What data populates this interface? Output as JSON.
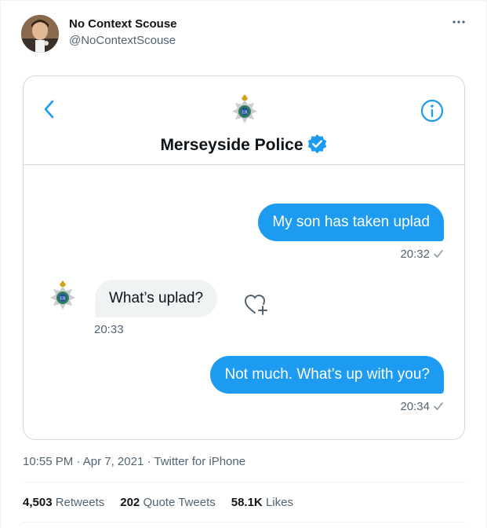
{
  "author": {
    "display_name": "No Context Scouse",
    "handle": "@NoContextScouse"
  },
  "dm": {
    "contact_name": "Merseyside Police",
    "messages": [
      {
        "direction": "outgoing",
        "text": "My son has taken uplad",
        "time": "20:32"
      },
      {
        "direction": "incoming",
        "text": "What’s uplad?",
        "time": "20:33"
      },
      {
        "direction": "outgoing",
        "text": "Not much. What’s up with you?",
        "time": "20:34"
      }
    ]
  },
  "tweet_meta": {
    "time": "10:55 PM",
    "separator1": " · ",
    "date": "Apr 7, 2021",
    "separator2": " · ",
    "source": "Twitter for iPhone"
  },
  "stats": {
    "retweets_count": "4,503",
    "retweets_label": "Retweets",
    "quotes_count": "202",
    "quotes_label": "Quote Tweets",
    "likes_count": "58.1K",
    "likes_label": "Likes"
  },
  "colors": {
    "accent": "#1d9bf0",
    "text_secondary": "#536471",
    "bubble_incoming": "#eff3f4",
    "border": "#cfd9de"
  },
  "icons": [
    "more-icon",
    "back-chevron-icon",
    "info-icon",
    "police-badge-icon",
    "verified-icon",
    "read-tick-icon",
    "add-reaction-icon"
  ]
}
